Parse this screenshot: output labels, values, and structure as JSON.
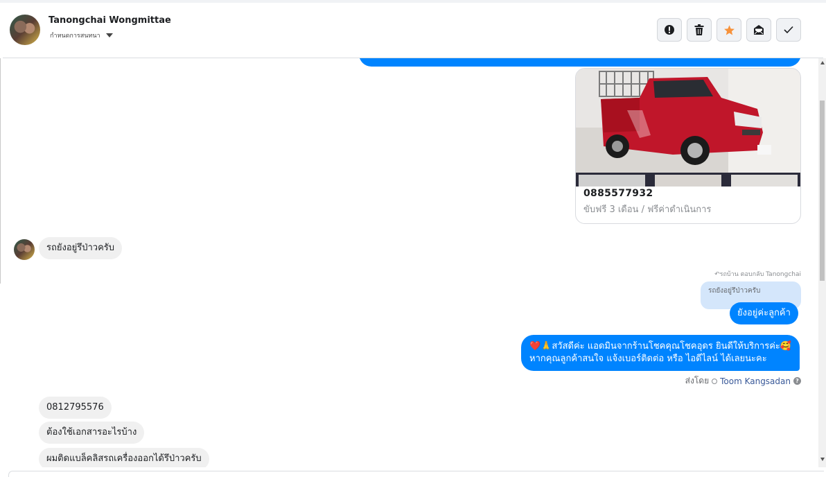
{
  "header": {
    "contact_name": "Tanongchai Wongmittae",
    "status_label": "กำหนดการสนทนา",
    "actions": [
      {
        "icon": "alert-icon"
      },
      {
        "icon": "trash-icon"
      },
      {
        "icon": "star-icon",
        "color": "#f7923b"
      },
      {
        "icon": "mark-unread-icon"
      },
      {
        "icon": "check-icon"
      }
    ]
  },
  "card": {
    "phone": "0885577932",
    "subtitle": "ขับฟรี 3 เดือน / ฟรีค่าดำเนินการ"
  },
  "messages": {
    "incoming_1": "รถยังอยู่รึป่าวครับ",
    "reply_note": "รถบ้าน ตอบกลับ Tanongchai",
    "quoted_text": "รถยังอยู่รึป่าวครับ",
    "outgoing_1": "ยังอยู่ค่ะลูกค้า",
    "outgoing_2_line1": "สวัสดีค่ะ แอดมินจากร้านโชคคุณโชคอุดร ยินดีให้บริการค่ะ",
    "outgoing_2_line2": "หากคุณลูกค้าสนใจ แจ้งเบอร์ติดต่อ หรือ ไอดีไลน์ ได้เลยนะคะ",
    "sent_by_label": "ส่งโดย",
    "sent_by_agent": "Toom Kangsadan",
    "incoming_2": "0812795576",
    "incoming_3": "ต้องใช้เอกสารอะไรบ้าง",
    "incoming_4": "ผมติดแบล็คลิสรถเครื่องออกได้รึป่าวครับ"
  },
  "colors": {
    "accent": "#0084ff",
    "incoming_bubble": "#f0f0f0",
    "quoted_bubble": "#d4e6fb"
  }
}
